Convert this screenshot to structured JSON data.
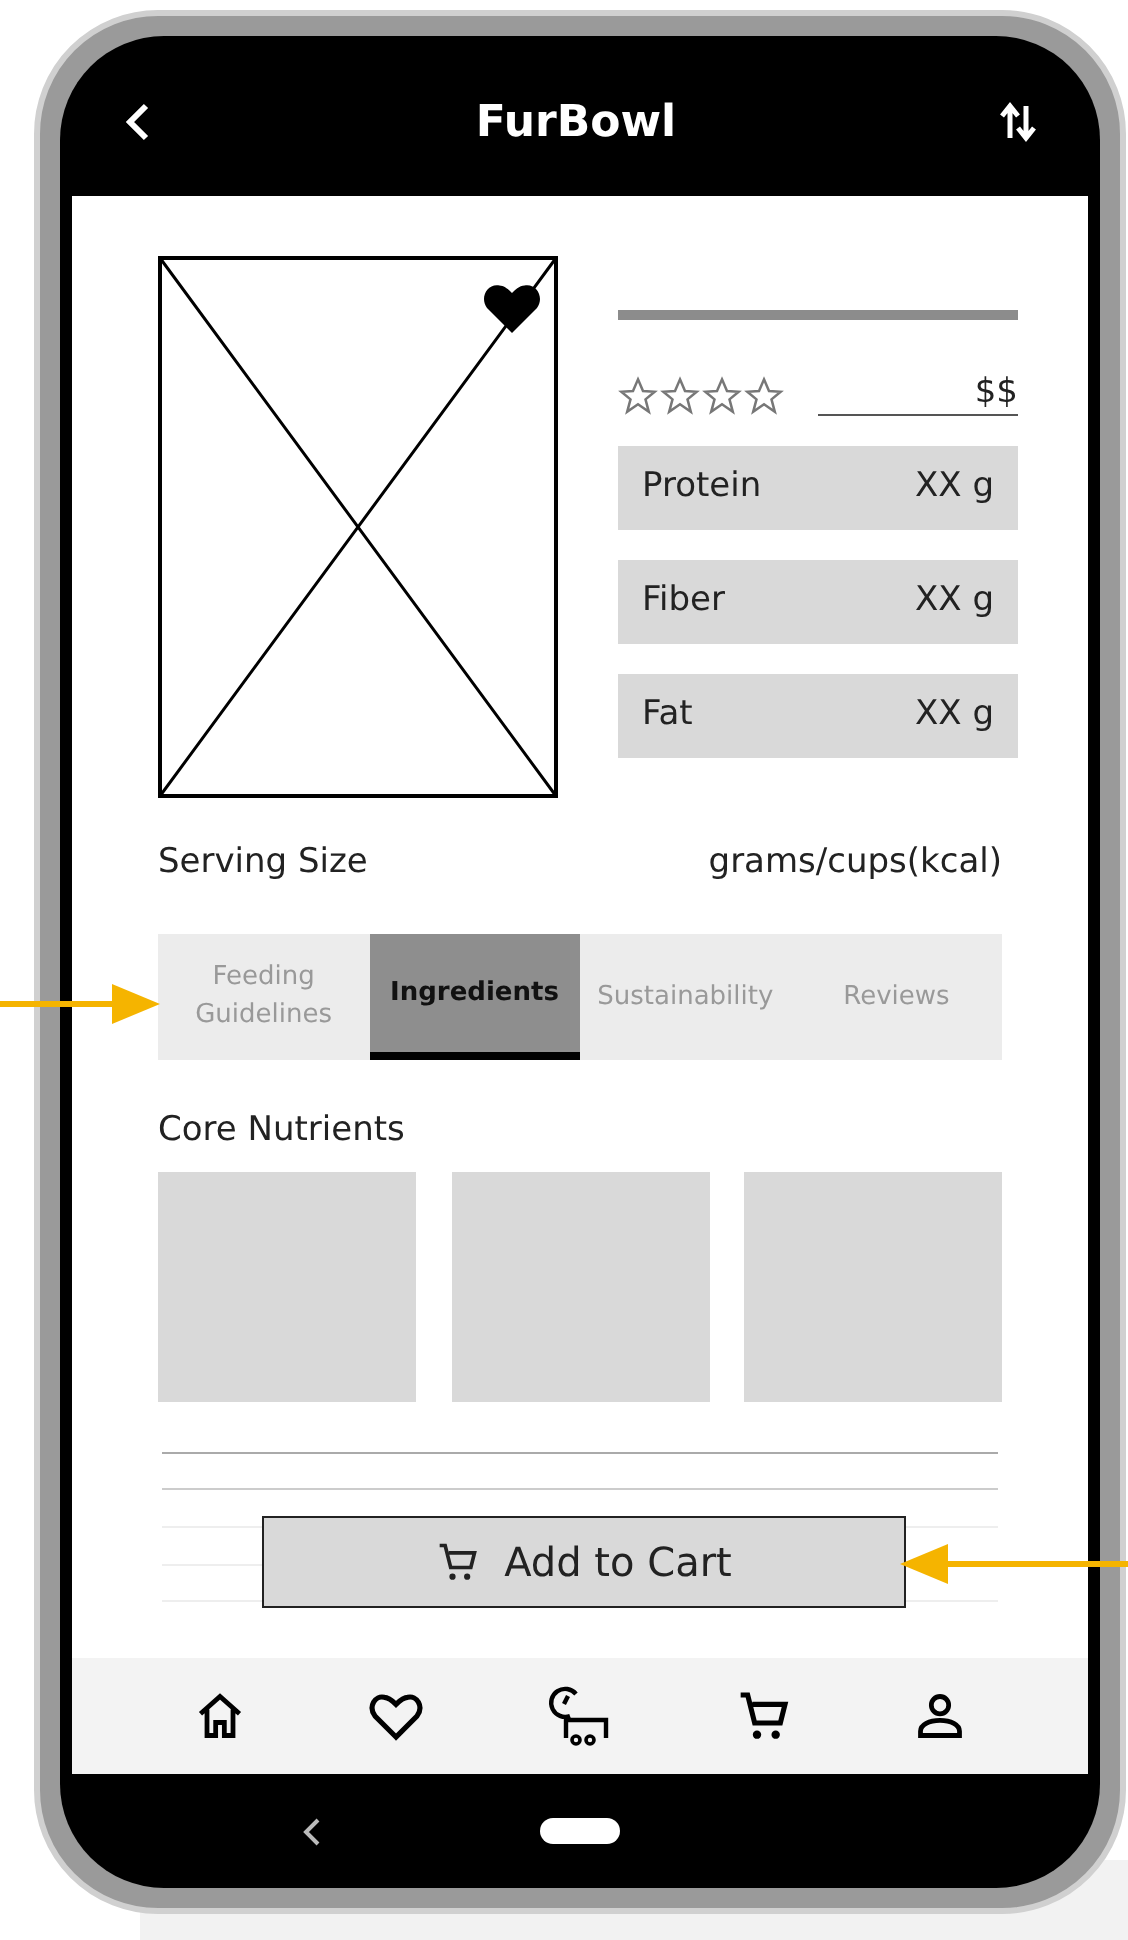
{
  "header": {
    "title": "FurBowl"
  },
  "product": {
    "stars": 0,
    "price": "$$",
    "nutrients": [
      {
        "label": "Protein",
        "value": "XX g"
      },
      {
        "label": "Fiber",
        "value": "XX g"
      },
      {
        "label": "Fat",
        "value": "XX g"
      }
    ]
  },
  "serving": {
    "label": "Serving Size",
    "value": "grams/cups(kcal)"
  },
  "tabs": [
    {
      "label": "Feeding Guidelines",
      "selected": false
    },
    {
      "label": "Ingredients",
      "selected": true
    },
    {
      "label": "Sustainability",
      "selected": false
    },
    {
      "label": "Reviews",
      "selected": false
    }
  ],
  "section_title": "Core Nutrients",
  "add_to_cart": {
    "label": "Add to Cart"
  }
}
